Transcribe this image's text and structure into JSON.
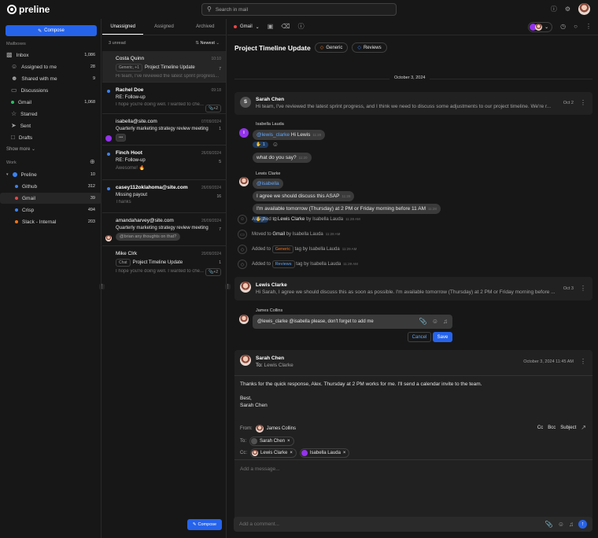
{
  "app": {
    "logo_text": "preline"
  },
  "search": {
    "placeholder": "Search in mail"
  },
  "sidebar": {
    "compose_label": "Compose",
    "mailboxes_label": "Mailboxes",
    "items": [
      {
        "label": "Inbox",
        "count": "1,086",
        "icon": "inbox-icon"
      },
      {
        "label": "Assigned to me",
        "count": "28",
        "icon": "user-icon"
      },
      {
        "label": "Shared with me",
        "count": "9",
        "icon": "users-icon"
      },
      {
        "label": "Discussions",
        "count": "",
        "icon": "chat-icon"
      },
      {
        "label": "Gmail",
        "count": "1,068",
        "icon": "gmail-icon"
      },
      {
        "label": "Starred",
        "count": "",
        "icon": "star-icon"
      },
      {
        "label": "Sent",
        "count": "",
        "icon": "send-icon"
      },
      {
        "label": "Drafts",
        "count": "",
        "icon": "file-icon"
      }
    ],
    "show_more": "Show more",
    "work_label": "Work",
    "work_items": [
      {
        "label": "Preline",
        "count": "10",
        "color": "#3b82f6"
      },
      {
        "label": "Github",
        "count": "312",
        "color": "#3b82f6"
      },
      {
        "label": "Gmail",
        "count": "39",
        "color": "#ef4444"
      },
      {
        "label": "Crisp",
        "count": "494",
        "color": "#3b82f6"
      },
      {
        "label": "Slack - Internal",
        "count": "203",
        "color": "#f97316"
      }
    ]
  },
  "list": {
    "tabs": [
      "Unassigned",
      "Assigned",
      "Archived"
    ],
    "unread": "3 unread",
    "sort": "Newest",
    "compose_label": "Compose",
    "mails": [
      {
        "from": "Costa Quinn",
        "date": "10:10",
        "subject": "Project Timeline Update",
        "chip": "Generic, +1",
        "snippet": "Hi team, I've reviewed the latest sprint progress...",
        "count": "7"
      },
      {
        "from": "Rachel Doe",
        "date": "09:18",
        "subject": "RE: Follow-up",
        "snippet": "I hope you're doing well. I wanted to che...",
        "count": "",
        "chip": "+2"
      },
      {
        "from": "isabella@site.com",
        "date": "07/09/2024",
        "subject": "Quarterly marketing strategy review meeting",
        "snippet": "",
        "count": "1",
        "chip": "•••"
      },
      {
        "from": "Finch Hoot",
        "date": "26/09/2024",
        "subject": "RE: Follow-up",
        "snippet": "Awesome! 🔥",
        "count": "5"
      },
      {
        "from": "casey112oklahoma@site.com",
        "date": "26/09/2024",
        "subject": "Missing payout",
        "snippet": "Thanks",
        "count": "16"
      },
      {
        "from": "amandaharvey@site.com",
        "date": "26/09/2024",
        "subject": "Quarterly marketing strategy review meeting",
        "snippet": "@brian any thoughts on that?",
        "count": "7"
      },
      {
        "from": "Mike Clrk",
        "date": "20/09/2024",
        "subject": "Project Timeline Update",
        "chip": "Chat",
        "snippet": "I hope you're doing well. I wanted to che...",
        "count": "1",
        "chip2": "+2"
      }
    ]
  },
  "main": {
    "toolbar": {
      "label": "Gmail"
    },
    "title": "Project Timeline Update",
    "tags": [
      "Generic",
      "Reviews"
    ],
    "date_sep": "October 3, 2024",
    "email1": {
      "avatar": "S",
      "name": "Sarah Chen",
      "text": "Hi team, I've reviewed the latest sprint progress, and I think we need to discuss some adjustments to our project timeline. We're r...",
      "date": "Oct 2"
    },
    "chat1": {
      "name": "Isabella Lauda",
      "mention": "@lewis_clarke",
      "msg1": "Hi Lewis",
      "time1": "11:20",
      "react": "1",
      "msg2": "what do you say?",
      "time2": "11:20",
      "avatar": "I"
    },
    "chat2": {
      "name": "Lewis Clarke",
      "mention": "@isabella",
      "msg1": "I agree we should discuss this ASAP",
      "time1": "11:28",
      "msg2": "I'm available tomorrow (Thursday) at 2 PM or Friday morning before 11 AM",
      "time2": "11:28",
      "react": "2"
    },
    "activity": [
      {
        "pre": "Assigned to",
        "who": "Lewis Clarke",
        "by": "by Isabella Lauda",
        "time": "11:28 AM"
      },
      {
        "pre": "Moved to",
        "who": "Gmail",
        "by": "by Isabella Lauda",
        "time": "11:28 AM"
      },
      {
        "pre": "Added to",
        "tag": "Generic",
        "by": "tag by Isabella Lauda",
        "time": "11:29 AM"
      },
      {
        "pre": "Added to",
        "tag": "Reviews",
        "by": "tag by Isabella Lauda",
        "time": "11:29 AM"
      }
    ],
    "email2": {
      "name": "Lewis Clarke",
      "text": "Hi Sarah, I agree we should discuss this as soon as possible. I'm available tomorrow (Thursday) at 2 PM or Friday morning before ...",
      "date": "Oct 3"
    },
    "draft": {
      "name": "James Collins",
      "text": "@lewis_clarke @isabella please, don't forget to add me",
      "cancel": "Cancel",
      "save": "Save"
    },
    "email3": {
      "name": "Sarah Chen",
      "to_label": "To:",
      "to": "Lewis Clarke",
      "date": "October 3, 2024 11:45 AM",
      "body": "Thanks for the quick response, Alex. Thursday at 2 PM works for me. I'll send a calendar invite to the team.",
      "sign1": "Best,",
      "sign2": "Sarah Chen"
    },
    "reply": {
      "from_label": "From:",
      "from": "James Collins",
      "to_label": "To:",
      "to": "Sarah Chen",
      "cc_label": "Cc:",
      "cc1": "Lewis Clarke",
      "cc2": "Isabella Lauda",
      "cc": "Cc",
      "bcc": "Bcc",
      "subject": "Subject",
      "placeholder": "Add a message..."
    },
    "comment_placeholder": "Add a comment..."
  }
}
